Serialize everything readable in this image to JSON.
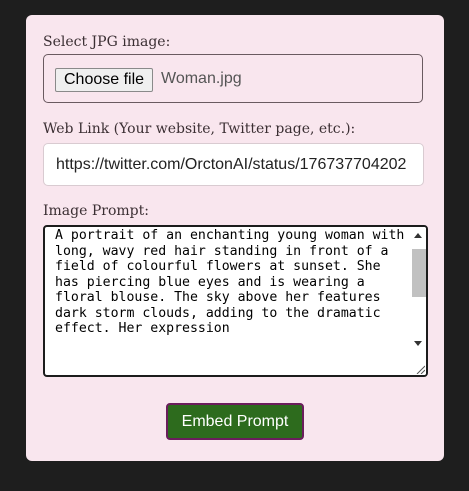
{
  "form": {
    "image_label": "Select JPG image:",
    "choose_file_label": "Choose file",
    "file_name": "Woman.jpg",
    "link_label": "Web Link (Your website, Twitter page, etc.):",
    "link_value": "https://twitter.com/OrctonAI/status/176737704202",
    "prompt_label": "Image Prompt:",
    "prompt_value": "A portrait of an enchanting young woman with long, wavy red hair standing in front of a field of colourful flowers at sunset. She has piercing blue eyes and is wearing a floral blouse. The sky above her features dark storm clouds, adding to the dramatic effect. Her expression",
    "embed_button_label": "Embed Prompt"
  },
  "colors": {
    "card_background": "#f9e6ee",
    "page_background": "#1e1e1e",
    "embed_button_background": "#2d6b1d",
    "embed_button_border": "#6b1d5c"
  }
}
